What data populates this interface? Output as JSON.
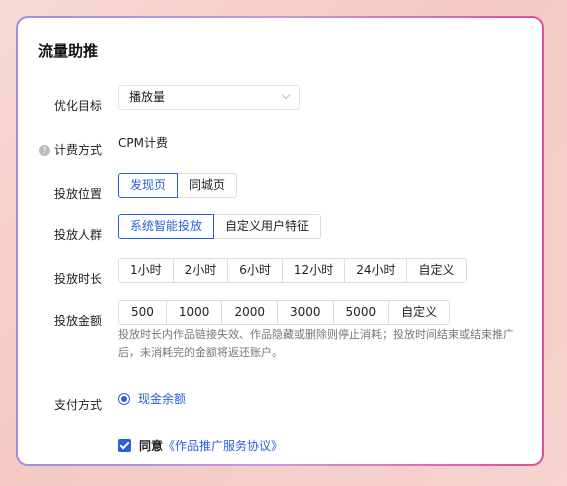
{
  "title": "流量助推",
  "optimize": {
    "label": "优化目标",
    "value": "播放量"
  },
  "billing": {
    "label": "计费方式",
    "value": "CPM计费"
  },
  "position": {
    "label": "投放位置",
    "options": [
      "发现页",
      "同城页"
    ],
    "active": 0
  },
  "audience": {
    "label": "投放人群",
    "options": [
      "系统智能投放",
      "自定义用户特征"
    ],
    "active": 0
  },
  "duration": {
    "label": "投放时长",
    "options": [
      "1小时",
      "2小时",
      "6小时",
      "12小时",
      "24小时",
      "自定义"
    ]
  },
  "amount": {
    "label": "投放金额",
    "options": [
      "500",
      "1000",
      "2000",
      "3000",
      "5000",
      "自定义"
    ]
  },
  "note": "投放时长内作品链接失效、作品隐藏或删除则停止消耗；投放时间结束或结束推广后，未消耗完的金额将返还账户。",
  "payment": {
    "label": "支付方式",
    "option": "现金余额"
  },
  "agreement": {
    "prefix": "同意",
    "link": "《作品推广服务协议》"
  },
  "colors": {
    "accent": "#2a5fe0",
    "gradient_start": "#9b8ee6",
    "gradient_end": "#e04f97"
  }
}
